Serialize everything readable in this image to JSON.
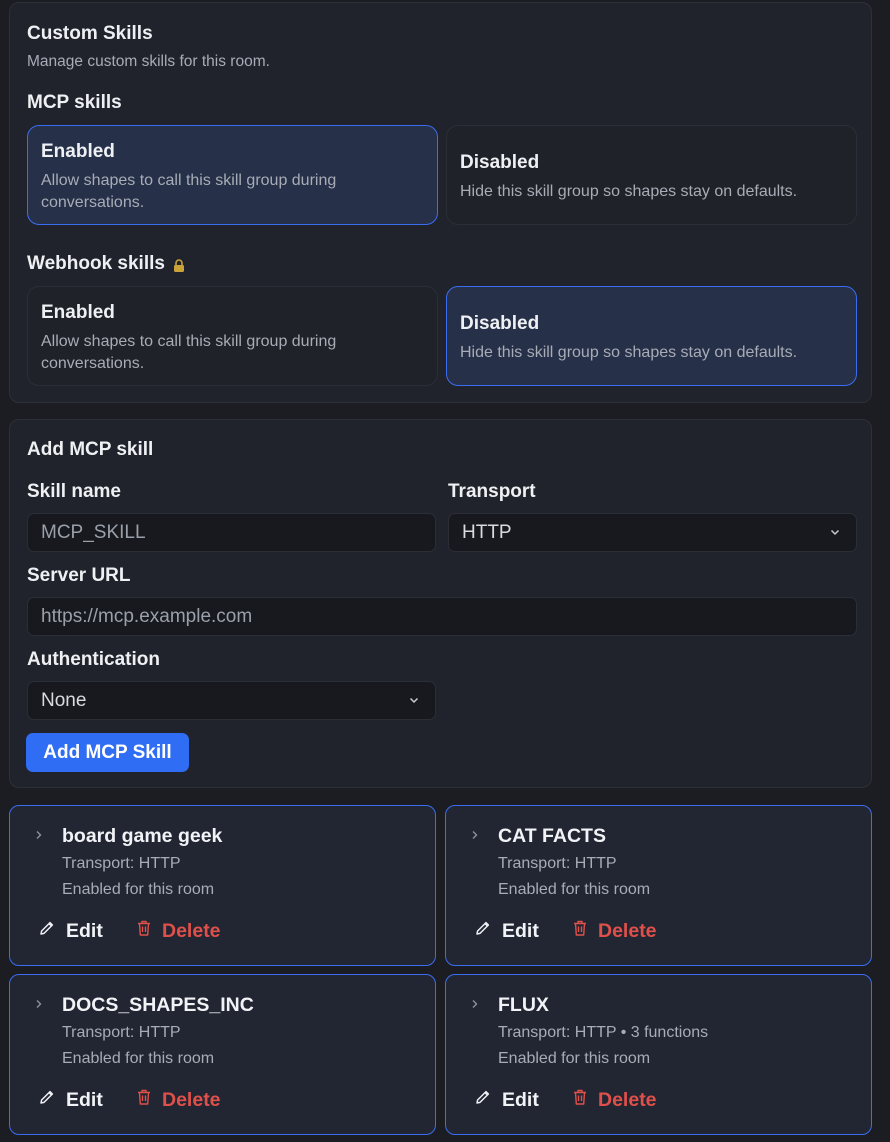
{
  "custom_skills": {
    "title": "Custom Skills",
    "subtitle": "Manage custom skills for this room."
  },
  "mcp_skills": {
    "title": "MCP skills",
    "options": [
      {
        "label": "Enabled",
        "description": "Allow shapes to call this skill group during conversations.",
        "selected": true
      },
      {
        "label": "Disabled",
        "description": "Hide this skill group so shapes stay on defaults.",
        "selected": false
      }
    ]
  },
  "webhook_skills": {
    "title": "Webhook skills",
    "lock_icon": "lock-icon",
    "options": [
      {
        "label": "Enabled",
        "description": "Allow shapes to call this skill group during conversations.",
        "selected": false
      },
      {
        "label": "Disabled",
        "description": "Hide this skill group so shapes stay on defaults.",
        "selected": true
      }
    ]
  },
  "add_form": {
    "title": "Add MCP skill",
    "skill_name_label": "Skill name",
    "skill_name_placeholder": "MCP_SKILL",
    "transport_label": "Transport",
    "transport_value": "HTTP",
    "server_url_label": "Server URL",
    "server_url_placeholder": "https://mcp.example.com",
    "auth_label": "Authentication",
    "auth_value": "None",
    "submit_label": "Add MCP Skill"
  },
  "skills": [
    {
      "name": "board game geek",
      "transport": "Transport: HTTP",
      "status": "Enabled for this room",
      "edit": "Edit",
      "delete": "Delete"
    },
    {
      "name": "CAT FACTS",
      "transport": "Transport: HTTP",
      "status": "Enabled for this room",
      "edit": "Edit",
      "delete": "Delete"
    },
    {
      "name": "DOCS_SHAPES_INC",
      "transport": "Transport: HTTP",
      "status": "Enabled for this room",
      "edit": "Edit",
      "delete": "Delete"
    },
    {
      "name": "FLUX",
      "transport": "Transport: HTTP • 3 functions",
      "status": "Enabled for this room",
      "edit": "Edit",
      "delete": "Delete"
    }
  ],
  "colors": {
    "accent": "#2f6df4",
    "selected_border": "#3a6df0",
    "danger": "#e0504a",
    "background": "#1b1d23"
  }
}
